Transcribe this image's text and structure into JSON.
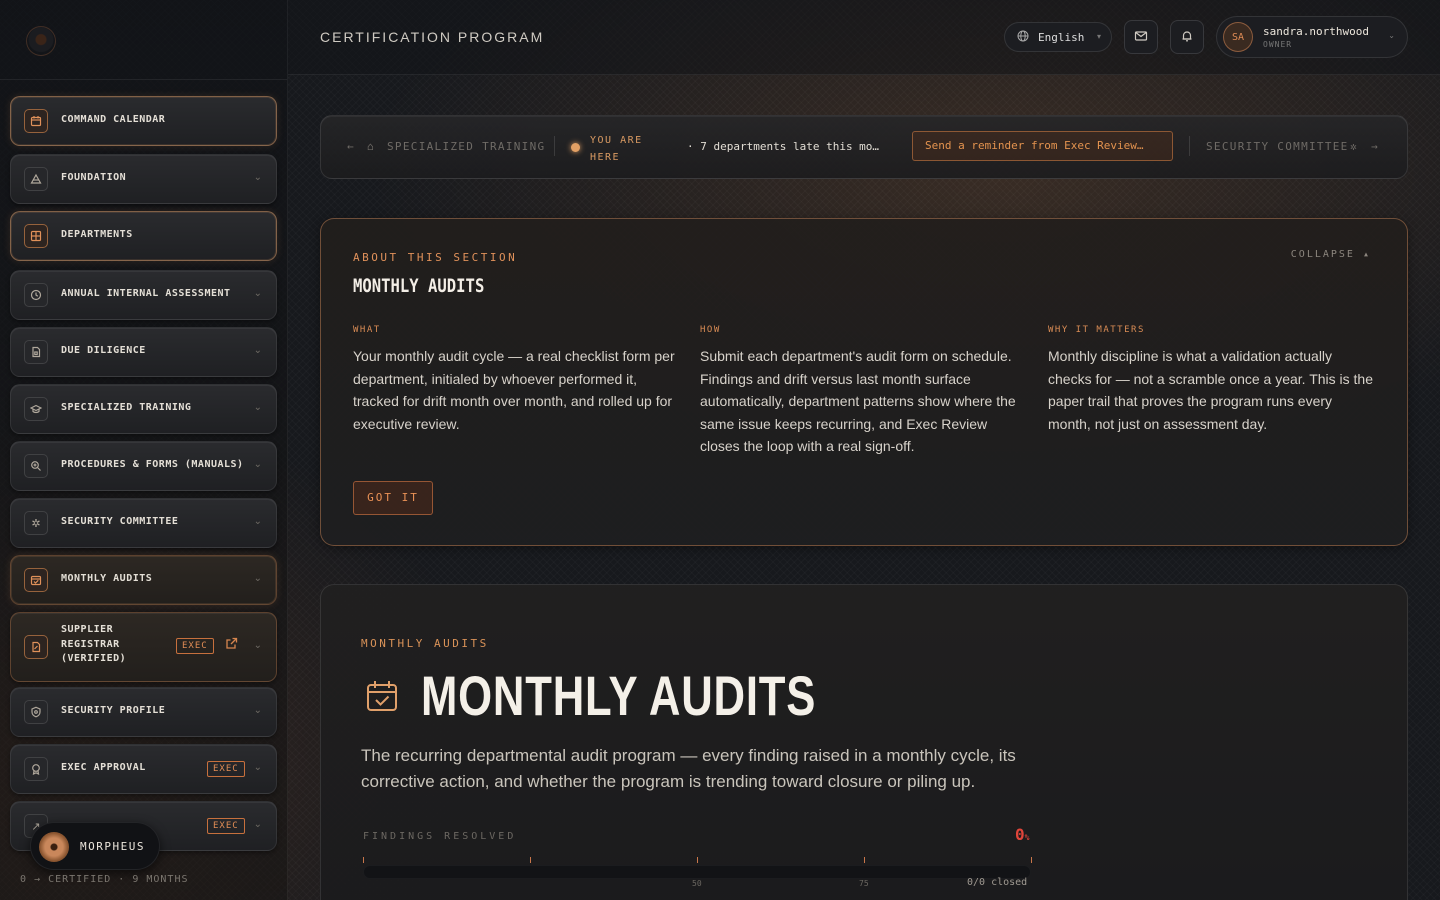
{
  "header": {
    "title": "CERTIFICATION PROGRAM",
    "language": "English",
    "user": {
      "initials": "SA",
      "name": "sandra.northwood",
      "role": "OWNER"
    }
  },
  "sidebar": {
    "items": [
      {
        "label": "COMMAND CALENDAR",
        "icon": "calendar-icon"
      },
      {
        "label": "FOUNDATION",
        "icon": "pyramid-icon"
      },
      {
        "label": "DEPARTMENTS",
        "icon": "grid-icon"
      },
      {
        "label": "ANNUAL INTERNAL ASSESSMENT",
        "icon": "clock-icon"
      },
      {
        "label": "DUE DILIGENCE",
        "icon": "document-icon"
      },
      {
        "label": "SPECIALIZED TRAINING",
        "icon": "graduation-cap-icon"
      },
      {
        "label": "PROCEDURES & FORMS (MANUALS)",
        "icon": "magnifier-icon"
      },
      {
        "label": "SECURITY COMMITTEE",
        "icon": "gear-icon"
      },
      {
        "label": "MONTHLY AUDITS",
        "icon": "calendar-check-icon"
      },
      {
        "label": "SUPPLIER REGISTRAR (VERIFIED)",
        "icon": "certificate-icon",
        "badge": "EXEC"
      },
      {
        "label": "SECURITY PROFILE",
        "icon": "shield-icon"
      },
      {
        "label": "EXEC APPROVAL",
        "icon": "seal-icon",
        "badge": "EXEC"
      },
      {
        "label": "",
        "icon": "arrow-icon",
        "badge": "EXEC"
      }
    ],
    "assistant": "MORPHEUS",
    "footer": "0 → CERTIFIED · 9 MONTHS"
  },
  "breadcrumb": {
    "prev": "SPECIALIZED TRAINING",
    "here": "YOU ARE HERE",
    "late_notice": "· 7 departments late this mo…",
    "reminder_button": "Send a reminder from Exec Review…",
    "next": "SECURITY COMMITTEE"
  },
  "about": {
    "eyebrow": "ABOUT THIS SECTION",
    "title": "MONTHLY AUDITS",
    "collapse": "COLLAPSE ▴",
    "columns": [
      {
        "label": "WHAT",
        "body": "Your monthly audit cycle — a real checklist form per department, initialed by whoever performed it, tracked for drift month over month, and rolled up for executive review."
      },
      {
        "label": "HOW",
        "body": "Submit each department's audit form on schedule. Findings and drift versus last month surface automatically, department patterns show where the same issue keeps recurring, and Exec Review closes the loop with a real sign-off."
      },
      {
        "label": "WHY IT MATTERS",
        "body": "Monthly discipline is what a validation actually checks for — not a scramble once a year. This is the paper trail that proves the program runs every month, not just on assessment day."
      }
    ],
    "button": "GOT IT"
  },
  "main": {
    "eyebrow": "MONTHLY AUDITS",
    "title": "MONTHLY AUDITS",
    "description": "The recurring departmental audit program — every finding raised in a monthly cycle, its corrective action, and whether the program is trending toward closure or piling up.",
    "progress": {
      "label": "FINDINGS RESOLVED",
      "percent": "0",
      "unit": "%",
      "fraction": 0,
      "tick_labels": [
        "50",
        "75"
      ],
      "closed": "0/0 closed"
    }
  },
  "colors": {
    "accent": "#e0915a",
    "danger": "#e0453a",
    "background": "#17191d"
  }
}
